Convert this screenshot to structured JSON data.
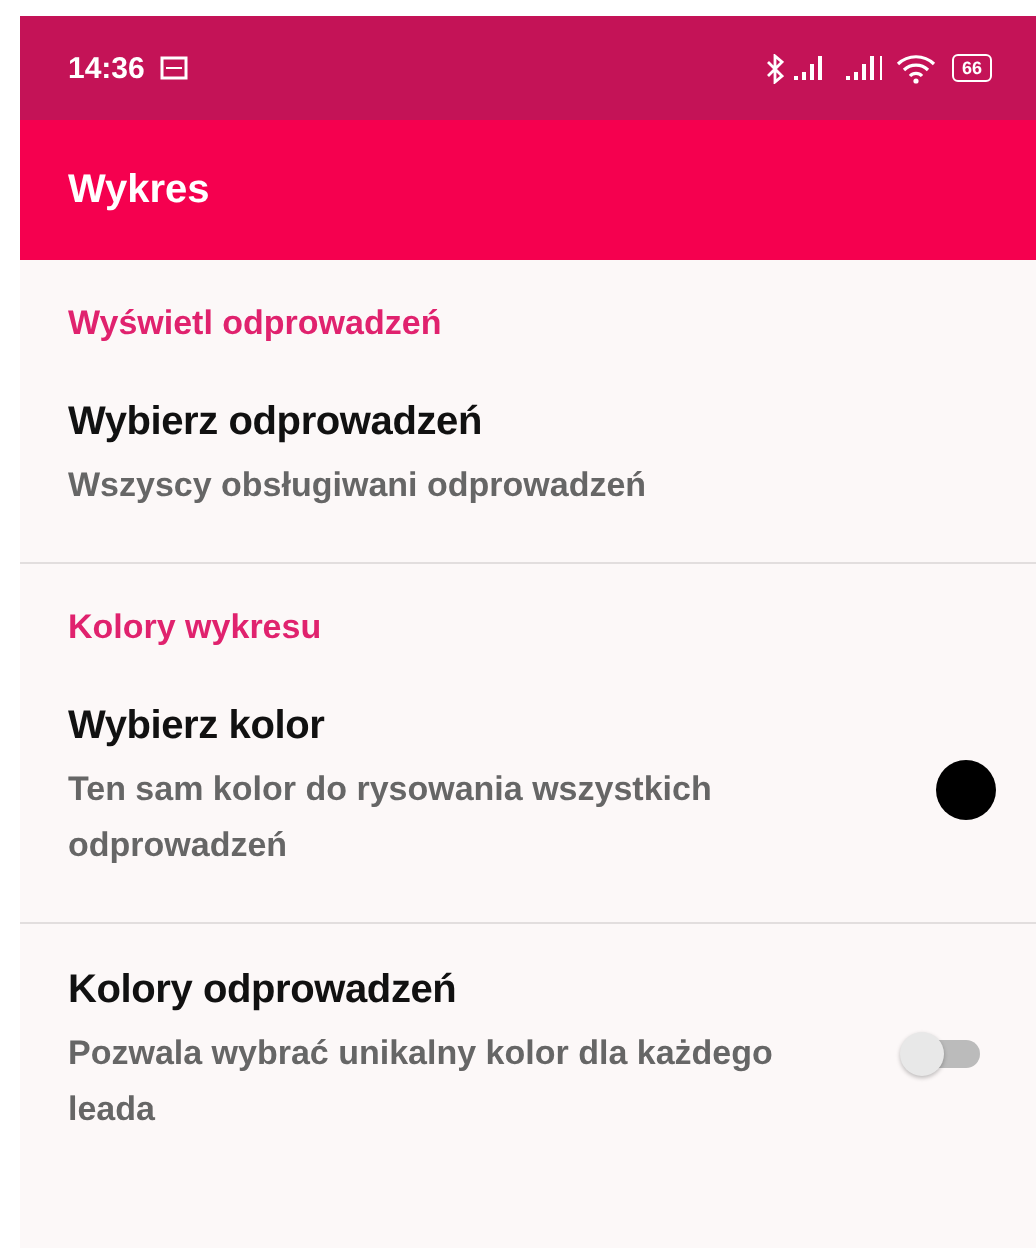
{
  "status_bar": {
    "time": "14:36",
    "battery": "66"
  },
  "app_bar": {
    "title": "Wykres"
  },
  "sections": [
    {
      "header": "Wyświetl odprowadzeń",
      "items": [
        {
          "kind": "plain",
          "title": "Wybierz odprowadzeń",
          "summary": "Wszyscy obsługiwani odprowadzeń"
        }
      ]
    },
    {
      "header": "Kolory wykresu",
      "items": [
        {
          "kind": "color",
          "title": "Wybierz kolor",
          "summary": "Ten sam kolor do rysowania wszystkich odprowadzeń",
          "color": "#000000"
        },
        {
          "kind": "switch",
          "title": "Kolory odprowadzeń",
          "summary": "Pozwala wybrać unikalny kolor dla każdego leada",
          "on": false
        }
      ]
    }
  ]
}
